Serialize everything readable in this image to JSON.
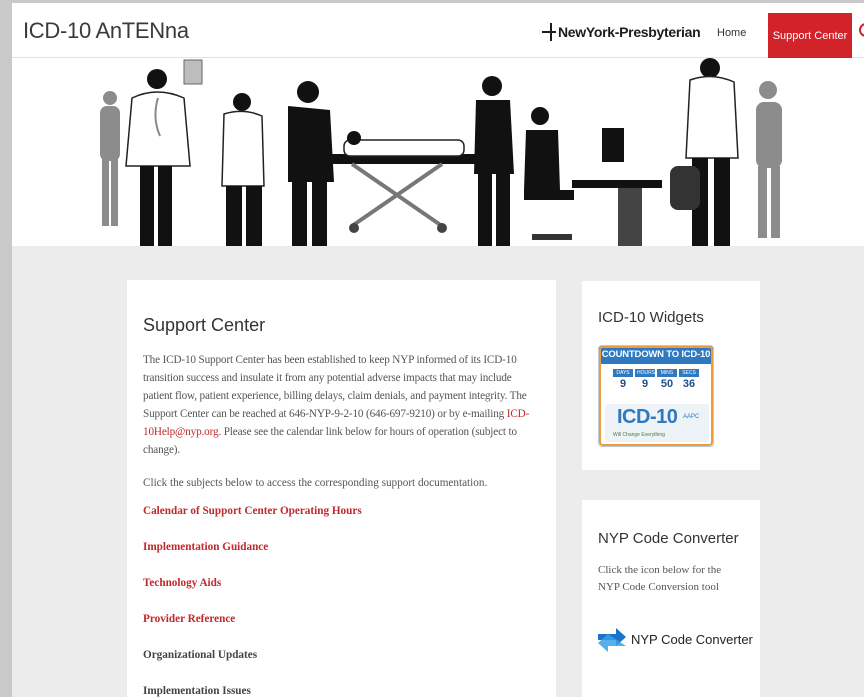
{
  "header": {
    "site_title": "ICD-10 AnTENna",
    "logo_text": "NewYork-Presbyterian",
    "nav": {
      "home": "Home",
      "support_center": "Support Center"
    }
  },
  "main": {
    "title": "Support Center",
    "intro_before_email": "The ICD-10 Support Center has been established to  keep NYP informed of its ICD-10 transition success and insulate it from any potential adverse impacts that may include patient flow, patient experience, billing delays, claim denials, and payment integrity.  The Support Center can be reached at 646-NYP-9-2-10 (646-697-9210) or by e-mailing ",
    "email": "ICD-10Help@nyp.org",
    "intro_after_email": ".  Please see the calendar link below for hours of operation (subject to change).",
    "subjects_text": "Click the subjects below to access the corresponding support documentation.",
    "links": [
      "Calendar of Support Center Operating Hours",
      "Implementation Guidance",
      "Technology Aids",
      "Provider Reference",
      "Organizational Updates",
      "Implementation Issues"
    ]
  },
  "widgets": {
    "title": "ICD-10 Widgets",
    "countdown": {
      "header": "COUNTDOWN TO ICD-10",
      "labels": [
        "DAYS",
        "HOURS",
        "MINS",
        "SECS"
      ],
      "values": [
        "9",
        "9",
        "50",
        "36"
      ],
      "logo": "ICD-10",
      "org": "AAPC",
      "tagline": "Will Change Everything"
    }
  },
  "converter": {
    "title": "NYP Code Converter",
    "description": "Click the icon below for the NYP Code Conversion tool",
    "button_label": "NYP Code Converter"
  },
  "colors": {
    "accent": "#d2232a",
    "link": "#c0282d",
    "background": "#ececec"
  }
}
